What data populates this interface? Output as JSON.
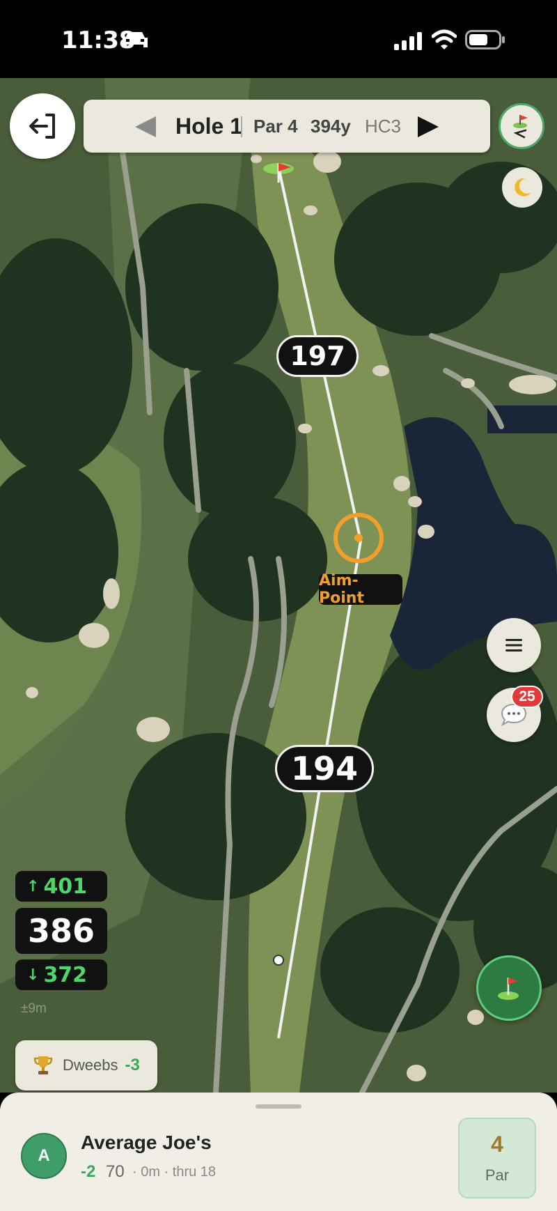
{
  "status_bar": {
    "time": "11:38"
  },
  "hole_nav": {
    "hole": "Hole 1",
    "par": "Par 4",
    "yardage": "394y",
    "handicap": "HC3"
  },
  "map": {
    "distance_to_green": "197",
    "distance_from_tee": "194",
    "aim_point_label": "Aim-Point"
  },
  "green_distances": {
    "back": "401",
    "center": "386",
    "front": "372",
    "accuracy": "±9m"
  },
  "chat": {
    "unread_count": "25"
  },
  "team": {
    "name": "Dweebs",
    "score": "-3"
  },
  "player": {
    "initial": "A",
    "name": "Average Joe's",
    "score_to_par": "-2",
    "strokes": "70",
    "meta": "· 0m · thru 18",
    "hole_par_value": "4",
    "hole_par_label": "Par"
  },
  "colors": {
    "accent_orange": "#f0a02a",
    "green_text": "#4fd66b",
    "avatar_green": "#3f9e68"
  }
}
